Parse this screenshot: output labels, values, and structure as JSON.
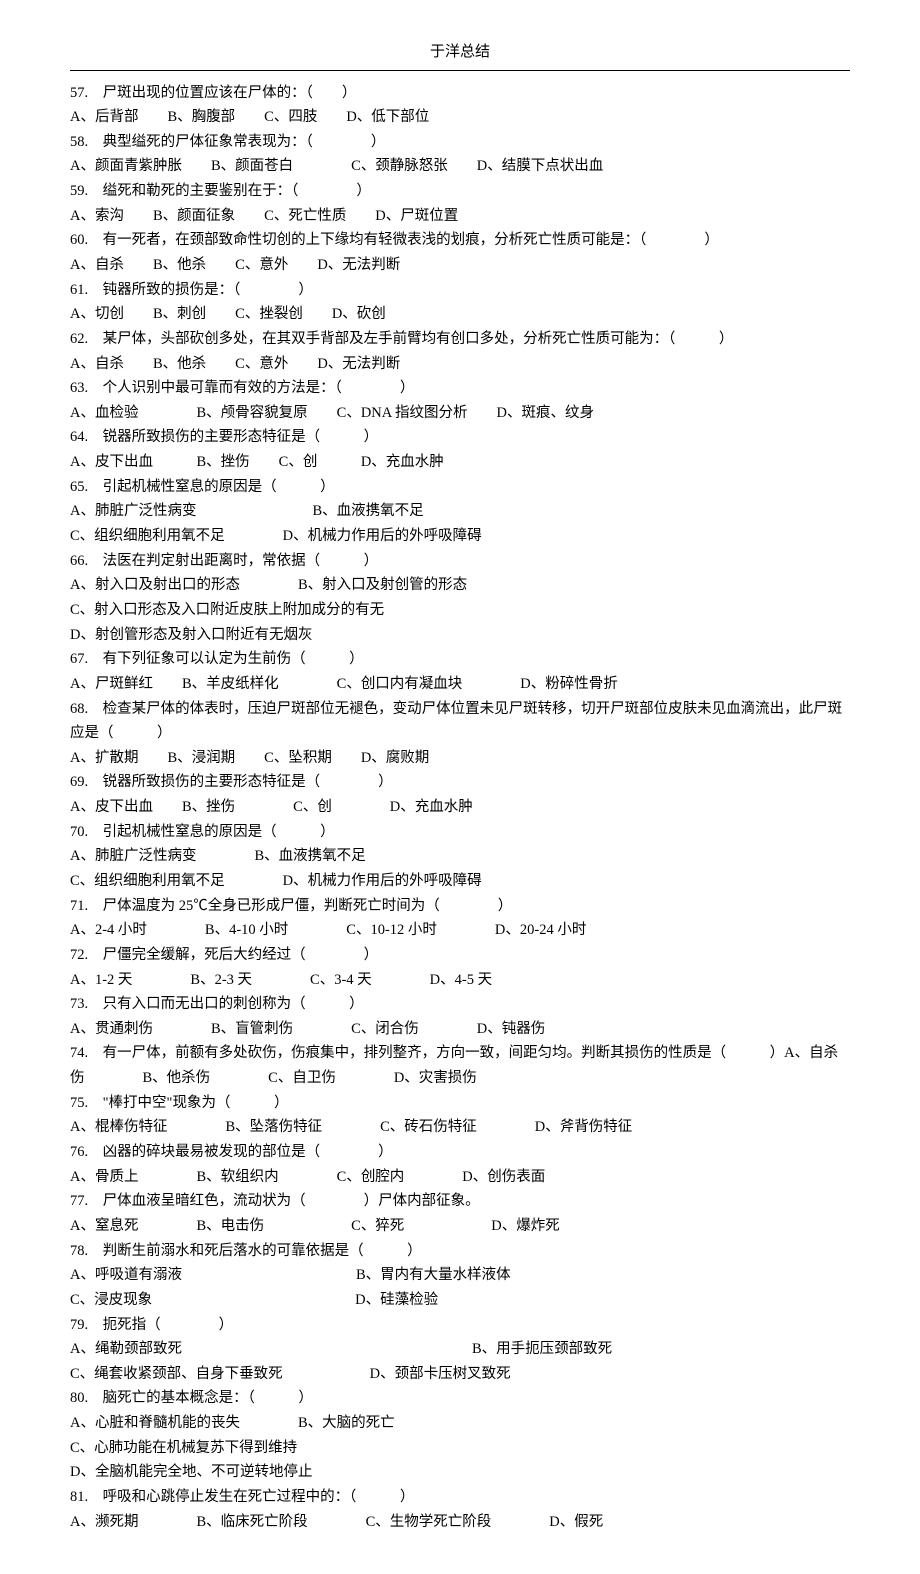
{
  "header": "于洋总结",
  "questions": [
    {
      "num": "57",
      "text": "尸斑出现的位置应该在尸体的：（　　）",
      "opts": "A、后背部　　B、胸腹部　　C、四肢　　D、低下部位"
    },
    {
      "num": "58",
      "text": "典型缢死的尸体征象常表现为：（　　　　）",
      "opts": "A、颜面青紫肿胀　　B、颜面苍白　　　　C、颈静脉怒张　　D、结膜下点状出血"
    },
    {
      "num": "59",
      "text": "缢死和勒死的主要鉴别在于：（　　　　）",
      "opts": "A、索沟　　B、颜面征象　　C、死亡性质　　D、尸斑位置"
    },
    {
      "num": "60",
      "text": "有一死者，在颈部致命性切创的上下缘均有轻微表浅的划痕，分析死亡性质可能是：（　　　　）",
      "opts": "A、自杀　　B、他杀　　C、意外　　D、无法判断"
    },
    {
      "num": "61",
      "text": "钝器所致的损伤是：（　　　　）",
      "opts": "A、切创　　B、刺创　　C、挫裂创　　D、砍创"
    },
    {
      "num": "62",
      "text": "某尸体，头部砍创多处，在其双手背部及左手前臂均有创口多处，分析死亡性质可能为：（　　　）",
      "opts": "A、自杀　　B、他杀　　C、意外　　D、无法判断"
    },
    {
      "num": "63",
      "text": "个人识别中最可靠而有效的方法是：（　　　　）",
      "opts": "A、血检验　　　　B、颅骨容貌复原　　C、DNA 指纹图分析　　D、斑痕、纹身"
    },
    {
      "num": "64",
      "text": "锐器所致损伤的主要形态特征是（　　　）",
      "opts": "A、皮下出血　　　B、挫伤　　C、创　　　D、充血水肿"
    },
    {
      "num": "65",
      "text": "引起机械性窒息的原因是（　　　）",
      "opts": "A、肺脏广泛性病变　　　　　　　　B、血液携氧不足\nC、组织细胞利用氧不足　　　　D、机械力作用后的外呼吸障碍"
    },
    {
      "num": "66",
      "text": "法医在判定射出距离时，常依据（　　　）",
      "opts": "A、射入口及射出口的形态　　　　B、射入口及射创管的形态\nC、射入口形态及入口附近皮肤上附加成分的有无\nD、射创管形态及射入口附近有无烟灰"
    },
    {
      "num": "67",
      "text": "有下列征象可以认定为生前伤（　　　）",
      "opts": "A、尸斑鲜红　　B、羊皮纸样化　　　　C、创口内有凝血块　　　　D、粉碎性骨折"
    },
    {
      "num": "68",
      "text": "检查某尸体的体表时，压迫尸斑部位无褪色，变动尸体位置未见尸斑转移，切开尸斑部位皮肤未见血滴流出，此尸斑应是（　　　）",
      "opts": "A、扩散期　　B、浸润期　　C、坠积期　　D、腐败期"
    },
    {
      "num": "69",
      "text": "锐器所致损伤的主要形态特征是（　　　　）",
      "opts": "A、皮下出血　　B、挫伤　　　　C、创　　　　D、充血水肿"
    },
    {
      "num": "70",
      "text": "引起机械性窒息的原因是（　　　）",
      "opts": "A、肺脏广泛性病变　　　　B、血液携氧不足\nC、组织细胞利用氧不足　　　　D、机械力作用后的外呼吸障碍"
    },
    {
      "num": "71",
      "text": "尸体温度为 25℃全身已形成尸僵，判断死亡时间为（　　　　）",
      "opts": "A、2-4 小时　　　　B、4-10 小时　　　　C、10-12 小时　　　　D、20-24 小时"
    },
    {
      "num": "72",
      "text": "尸僵完全缓解，死后大约经过（　　　　）",
      "opts": "A、1-2 天　　　　B、2-3 天　　　　C、3-4 天　　　　D、4-5 天"
    },
    {
      "num": "73",
      "text": "只有入口而无出口的刺创称为（　　　）",
      "opts": "A、贯通刺伤　　　　B、盲管刺伤　　　　C、闭合伤　　　　D、钝器伤"
    },
    {
      "num": "74",
      "text": "有一尸体，前额有多处砍伤，伤痕集中，排列整齐，方向一致，间距匀均。判断其损伤的性质是（　　　）A、自杀伤　　　　B、他杀伤　　　　C、自卫伤　　　　D、灾害损伤",
      "opts": ""
    },
    {
      "num": "75",
      "text": "\"棒打中空\"现象为（　　　）",
      "opts": "A、棍棒伤特征　　　　B、坠落伤特征　　　　C、砖石伤特征　　　　D、斧背伤特征"
    },
    {
      "num": "76",
      "text": "凶器的碎块最易被发现的部位是（　　　　）",
      "opts": "A、骨质上　　　　B、软组织内　　　　C、创腔内　　　　D、创伤表面"
    },
    {
      "num": "77",
      "text": "尸体血液呈暗红色，流动状为（　　　　）尸体内部征象。",
      "opts": "A、窒息死　　　　B、电击伤　　　　　　C、猝死　　　　　　D、爆炸死"
    },
    {
      "num": "78",
      "text": "判断生前溺水和死后落水的可靠依据是（　　　）",
      "opts": "A、呼吸道有溺液　　　　　　　　　　　　B、胃内有大量水样液体\nC、浸皮现象　　　　　　　　　　　　　　D、硅藻检验"
    },
    {
      "num": "79",
      "text": "扼死指（　　　　）",
      "opts": "A、绳勒颈部致死　　　　　　　　　　　　　　　　　　　　B、用手扼压颈部致死\nC、绳套收紧颈部、自身下垂致死　　　　　　D、颈部卡压树叉致死"
    },
    {
      "num": "80",
      "text": "脑死亡的基本概念是：（　　　）",
      "opts": "A、心脏和脊髓机能的丧失　　　　B、大脑的死亡\nC、心肺功能在机械复苏下得到维持\nD、全脑机能完全地、不可逆转地停止"
    },
    {
      "num": "81",
      "text": "呼吸和心跳停止发生在死亡过程中的：（　　　）",
      "opts": "A、濒死期　　　　B、临床死亡阶段　　　　C、生物学死亡阶段　　　　D、假死"
    }
  ]
}
